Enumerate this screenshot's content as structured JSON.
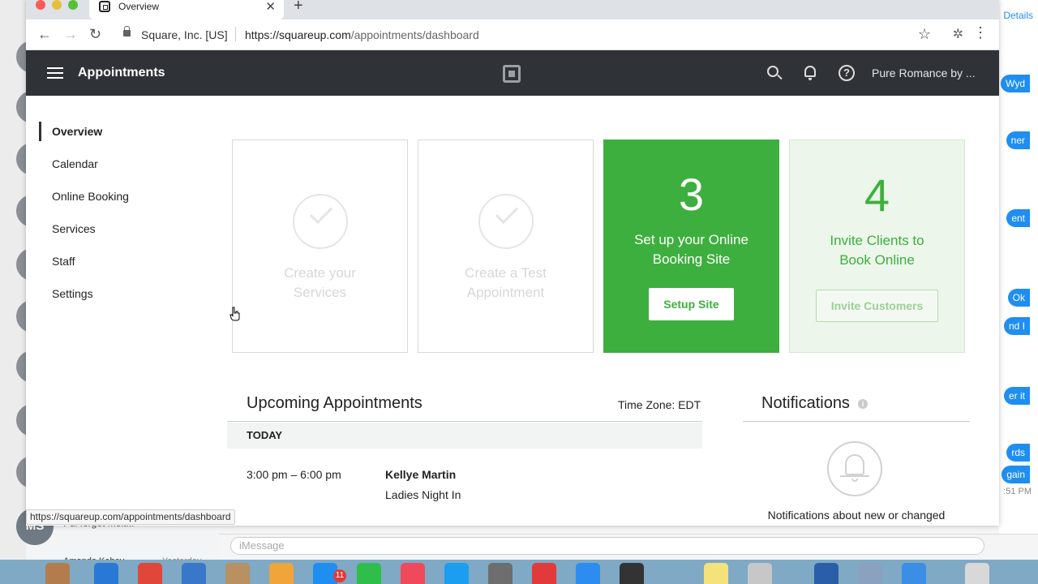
{
  "browser": {
    "tab_title": "Overview",
    "site_identity": "Square, Inc. [US]",
    "url_host": "https://squareup.com",
    "url_path": "/appointments/dashboard",
    "status_url": "https://squareup.com/appointments/dashboard"
  },
  "app": {
    "title": "Appointments",
    "account_name": "Pure Romance by ..."
  },
  "sidebar": {
    "items": [
      {
        "label": "Overview",
        "active": true
      },
      {
        "label": "Calendar"
      },
      {
        "label": "Online Booking"
      },
      {
        "label": "Services"
      },
      {
        "label": "Staff"
      },
      {
        "label": "Settings"
      }
    ]
  },
  "cards": {
    "services": {
      "label_line1": "Create your",
      "label_line2": "Services"
    },
    "test_appt": {
      "label_line1": "Create a Test",
      "label_line2": "Appointment"
    },
    "booking_site": {
      "step": "3",
      "label_line1": "Set up your Online",
      "label_line2": "Booking Site",
      "button": "Setup Site"
    },
    "invite": {
      "step": "4",
      "label_line1": "Invite Clients to",
      "label_line2": "Book Online",
      "button": "Invite Customers"
    }
  },
  "upcoming": {
    "title": "Upcoming Appointments",
    "timezone": "Time Zone: EDT",
    "group_label": "TODAY",
    "appointments": [
      {
        "time": "3:00 pm – 6:00 pm",
        "client": "Kellye Martin",
        "event": "Ladies Night In"
      }
    ]
  },
  "notifications": {
    "title": "Notifications",
    "empty_text": "Notifications about new or changed"
  },
  "background": {
    "details_link": "Details",
    "imessage_placeholder": "iMessage",
    "ms_initials": "MS",
    "preview_text": "Pul forgot molt...",
    "contact_name": "Amanda Kebey",
    "contact_time": "Yesterday",
    "time_fragment": ":51 PM",
    "bubbles": [
      "Wyd",
      "ner",
      "ent",
      "Ok",
      "nd I",
      "er it",
      "rds",
      "gain"
    ],
    "dock_badge": "11"
  },
  "colors": {
    "header_bg": "#2f3337",
    "accent_green": "#3daf3e",
    "imessage_blue": "#1f8ef1"
  }
}
